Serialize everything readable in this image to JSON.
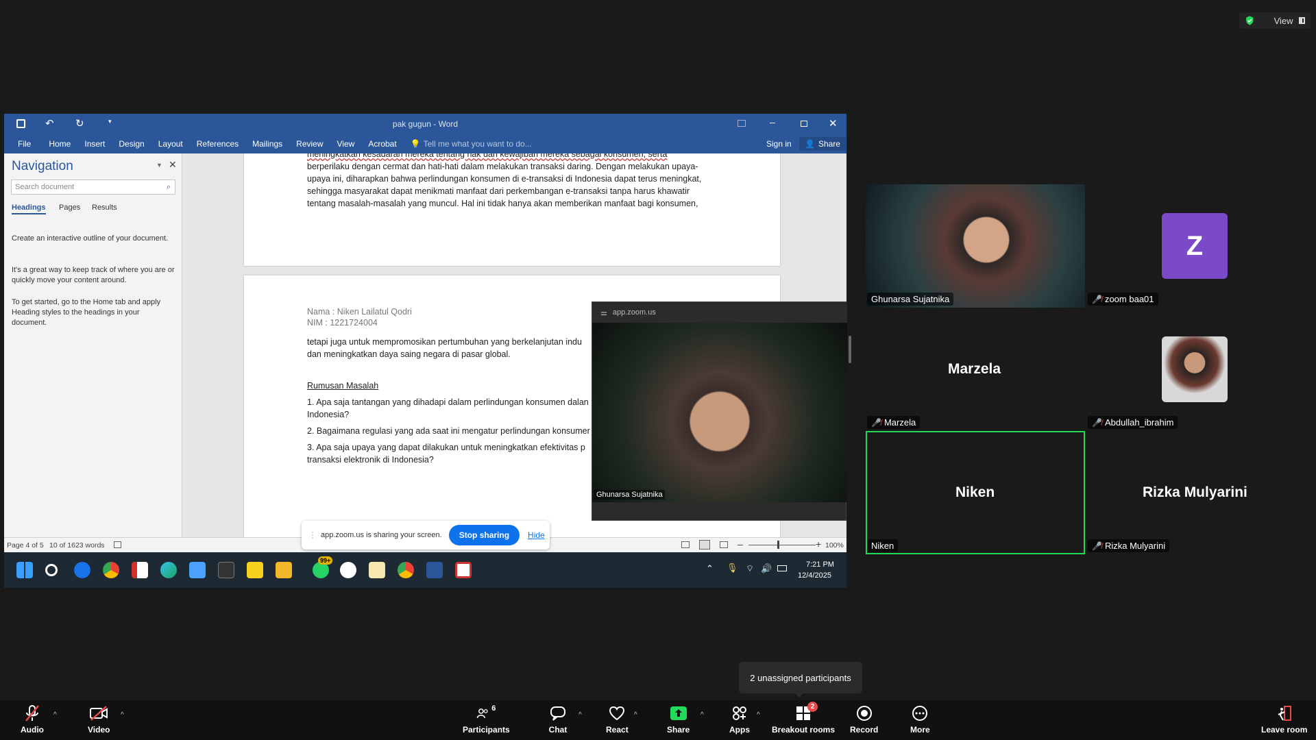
{
  "top_right": {
    "view_label": "View"
  },
  "word": {
    "title": "pak gugun - Word",
    "ribbon_tabs": [
      "File",
      "Home",
      "Insert",
      "Design",
      "Layout",
      "References",
      "Mailings",
      "Review",
      "View",
      "Acrobat"
    ],
    "tell_me": "Tell me what you want to do...",
    "sign_in": "Sign in",
    "share": "Share",
    "nav": {
      "title": "Navigation",
      "search_placeholder": "Search document",
      "tabs": [
        "Headings",
        "Pages",
        "Results"
      ],
      "help1": "Create an interactive outline of your document.",
      "help2": "It's a great way to keep track of where you are or quickly move your content around.",
      "help3": "To get started, go to the Home tab and apply Heading styles to the headings in your document."
    },
    "page1_lines": [
      "meningkatkan kesadaran mereka tentang hak dan kewajiban mereka sebagai konsumen, serta",
      "berperilaku dengan cermat dan hati-hati dalam melakukan transaksi daring. Dengan melakukan upaya-",
      "upaya ini, diharapkan bahwa perlindungan konsumen di e-transaksi di Indonesia dapat terus meningkat,",
      "sehingga masyarakat dapat menikmati manfaat dari perkembangan e-transaksi tanpa harus khawatir",
      "tentang masalah-masalah yang muncul. Hal ini tidak hanya akan memberikan manfaat bagi konsumen,"
    ],
    "page2": {
      "nama": "Nama : Niken Lailatul Qodri",
      "nim": "NIM    : 1221724004",
      "p1a": "tetapi juga untuk mempromosikan pertumbuhan yang berkelanjutan indu",
      "p1b": "dan meningkatkan daya saing negara di pasar global.",
      "heading": "Rumusan Masalah",
      "q1a": "1. Apa saja tantangan yang dihadapi dalam perlindungan konsumen dalan",
      "q1b": "Indonesia?",
      "q2": "2. Bagaimana regulasi yang ada saat ini mengatur perlindungan konsumer",
      "q3a": "3. Apa saja upaya yang dapat dilakukan untuk meningkatkan efektivitas p",
      "q3b": "transaksi elektronik di Indonesia?"
    },
    "status": {
      "page": "Page 4 of 5",
      "words": "10 of 1623 words",
      "zoom": "100%"
    }
  },
  "taskbar": {
    "time": "7:21 PM",
    "date": "12/4/2025",
    "badge": "99+"
  },
  "zoom_popup": {
    "title": "app.zoom.us",
    "name": "Ghunarsa Sujatnika"
  },
  "share_bar": {
    "text": "app.zoom.us is sharing your screen.",
    "stop": "Stop sharing",
    "hide": "Hide"
  },
  "gallery": {
    "tiles": [
      {
        "name": "Ghunarsa Sujatnika"
      },
      {
        "name": "zoom baa01",
        "initial": "Z"
      },
      {
        "name": "Marzela",
        "big": "Marzela"
      },
      {
        "name": "Abdullah_ibrahim"
      },
      {
        "name": "Niken",
        "big": "Niken"
      },
      {
        "name": "Rizka Mulyarini",
        "big": "Rizka Mulyarini"
      }
    ]
  },
  "tooltip": "2 unassigned participants",
  "toolbar": {
    "audio": "Audio",
    "video": "Video",
    "participants": "Participants",
    "participants_count": "6",
    "chat": "Chat",
    "react": "React",
    "share": "Share",
    "apps": "Apps",
    "breakout": "Breakout rooms",
    "breakout_badge": "2",
    "record": "Record",
    "more": "More",
    "leave": "Leave room"
  },
  "colors": {
    "word_blue": "#2b579a",
    "zoom_blue": "#0e72ed",
    "active_green": "#23d959",
    "mic_red": "#e84a4a"
  }
}
